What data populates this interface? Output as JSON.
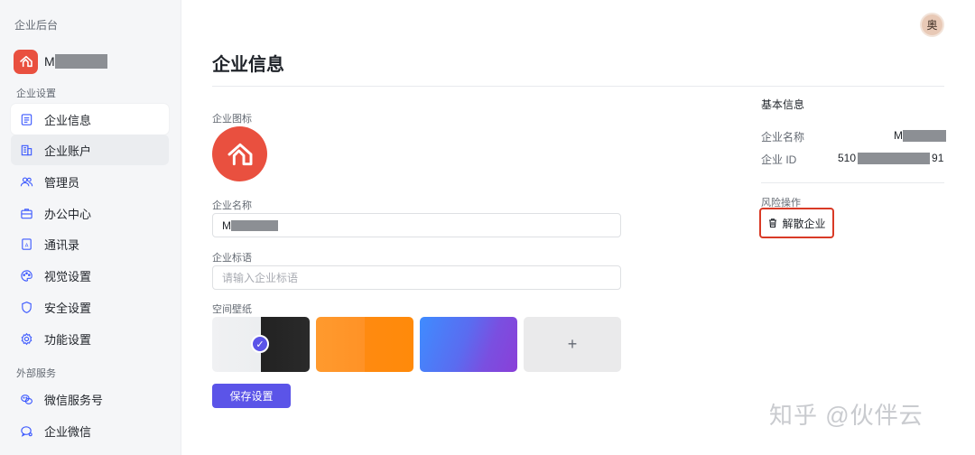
{
  "sidebar": {
    "app_title": "企业后台",
    "org_name_prefix": "M",
    "sections": {
      "settings": "企业设置",
      "external": "外部服务"
    },
    "items": [
      {
        "label": "企业信息",
        "icon": "document-icon"
      },
      {
        "label": "企业账户",
        "icon": "building-icon"
      },
      {
        "label": "管理员",
        "icon": "users-icon"
      },
      {
        "label": "办公中心",
        "icon": "briefcase-icon"
      },
      {
        "label": "通讯录",
        "icon": "contacts-icon"
      },
      {
        "label": "视觉设置",
        "icon": "palette-icon"
      },
      {
        "label": "安全设置",
        "icon": "shield-icon"
      },
      {
        "label": "功能设置",
        "icon": "gear-icon"
      },
      {
        "label": "微信服务号",
        "icon": "wechat-icon"
      },
      {
        "label": "企业微信",
        "icon": "wecom-icon"
      }
    ]
  },
  "header": {
    "avatar_text": "奥"
  },
  "main": {
    "title": "企业信息",
    "logo_label": "企业图标",
    "name_label": "企业名称",
    "name_value_prefix": "M",
    "slogan_label": "企业标语",
    "slogan_placeholder": "请输入企业标语",
    "wallpaper_label": "空间壁纸",
    "wallpaper_add": "+",
    "wallpaper_check": "✓",
    "save_label": "保存设置"
  },
  "info_panel": {
    "heading": "基本信息",
    "name_key": "企业名称",
    "name_value_prefix": "M",
    "id_key": "企业 ID",
    "id_prefix": "510",
    "id_suffix": "91",
    "risk_label": "风险操作",
    "dissolve_label": "解散企业"
  },
  "watermark": "知乎 @伙伴云",
  "colors": {
    "brand_red": "#e9503f",
    "primary": "#5b54e8",
    "danger_outline": "#d93a26"
  }
}
